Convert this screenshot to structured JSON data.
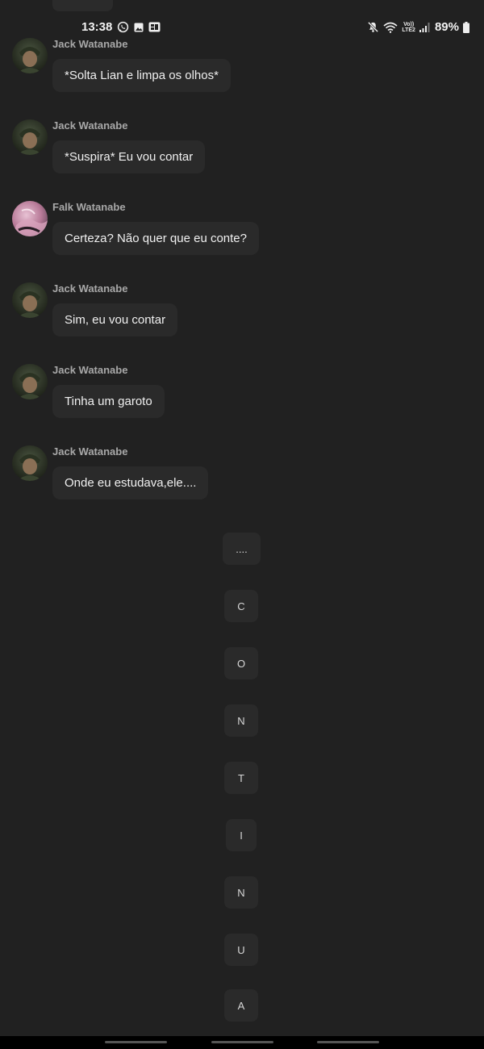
{
  "status": {
    "time": "13:38",
    "battery": "89%",
    "volte_top": "Vo))",
    "volte_bottom": "LTE2"
  },
  "messages": [
    {
      "sender": "Jack Watanabe",
      "text": "*Solta Lian e limpa os olhos*",
      "avatar": "jack"
    },
    {
      "sender": "Jack Watanabe",
      "text": "*Suspira* Eu vou contar",
      "avatar": "jack"
    },
    {
      "sender": "Falk Watanabe",
      "text": "Certeza? Não quer que eu conte?",
      "avatar": "falk"
    },
    {
      "sender": "Jack Watanabe",
      "text": "Sim, eu vou contar",
      "avatar": "jack"
    },
    {
      "sender": "Jack Watanabe",
      "text": "Tinha um garoto",
      "avatar": "jack"
    },
    {
      "sender": "Jack Watanabe",
      "text": "Onde eu estudava,ele....",
      "avatar": "jack"
    }
  ],
  "letter_buttons": [
    "....",
    "C",
    "O",
    "N",
    "T",
    "I",
    "N",
    "U",
    "A"
  ],
  "colors": {
    "background": "#212121",
    "bubble": "#2a2a2a",
    "sender_text": "#a8a8a8"
  }
}
